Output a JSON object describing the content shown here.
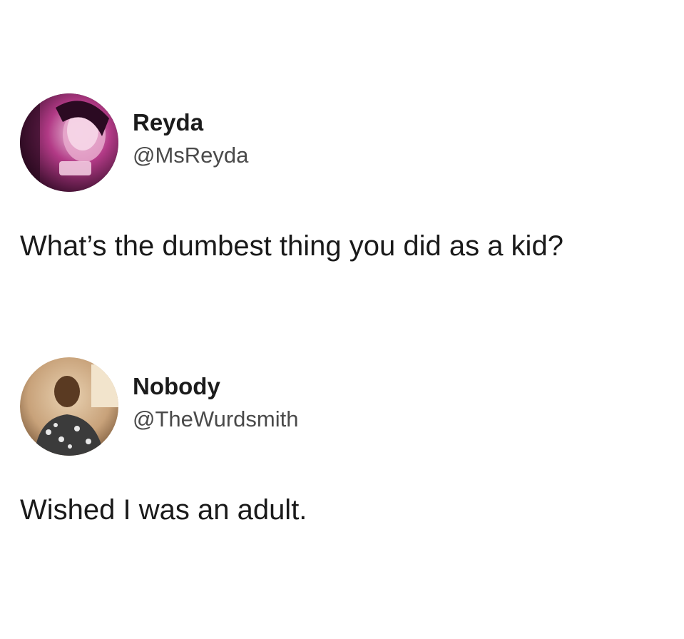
{
  "tweets": [
    {
      "display_name": "Reyda",
      "handle": "@MsReyda",
      "avatar_icon": "profile-photo",
      "text": "What’s the dumbest thing you did as a kid?"
    },
    {
      "display_name": "Nobody",
      "handle": "@TheWurdsmith",
      "avatar_icon": "profile-photo",
      "text": "Wished I was an adult."
    }
  ],
  "colors": {
    "background": "#ffffff",
    "text": "#1a1a1a",
    "handle": "#4a4a4a"
  }
}
